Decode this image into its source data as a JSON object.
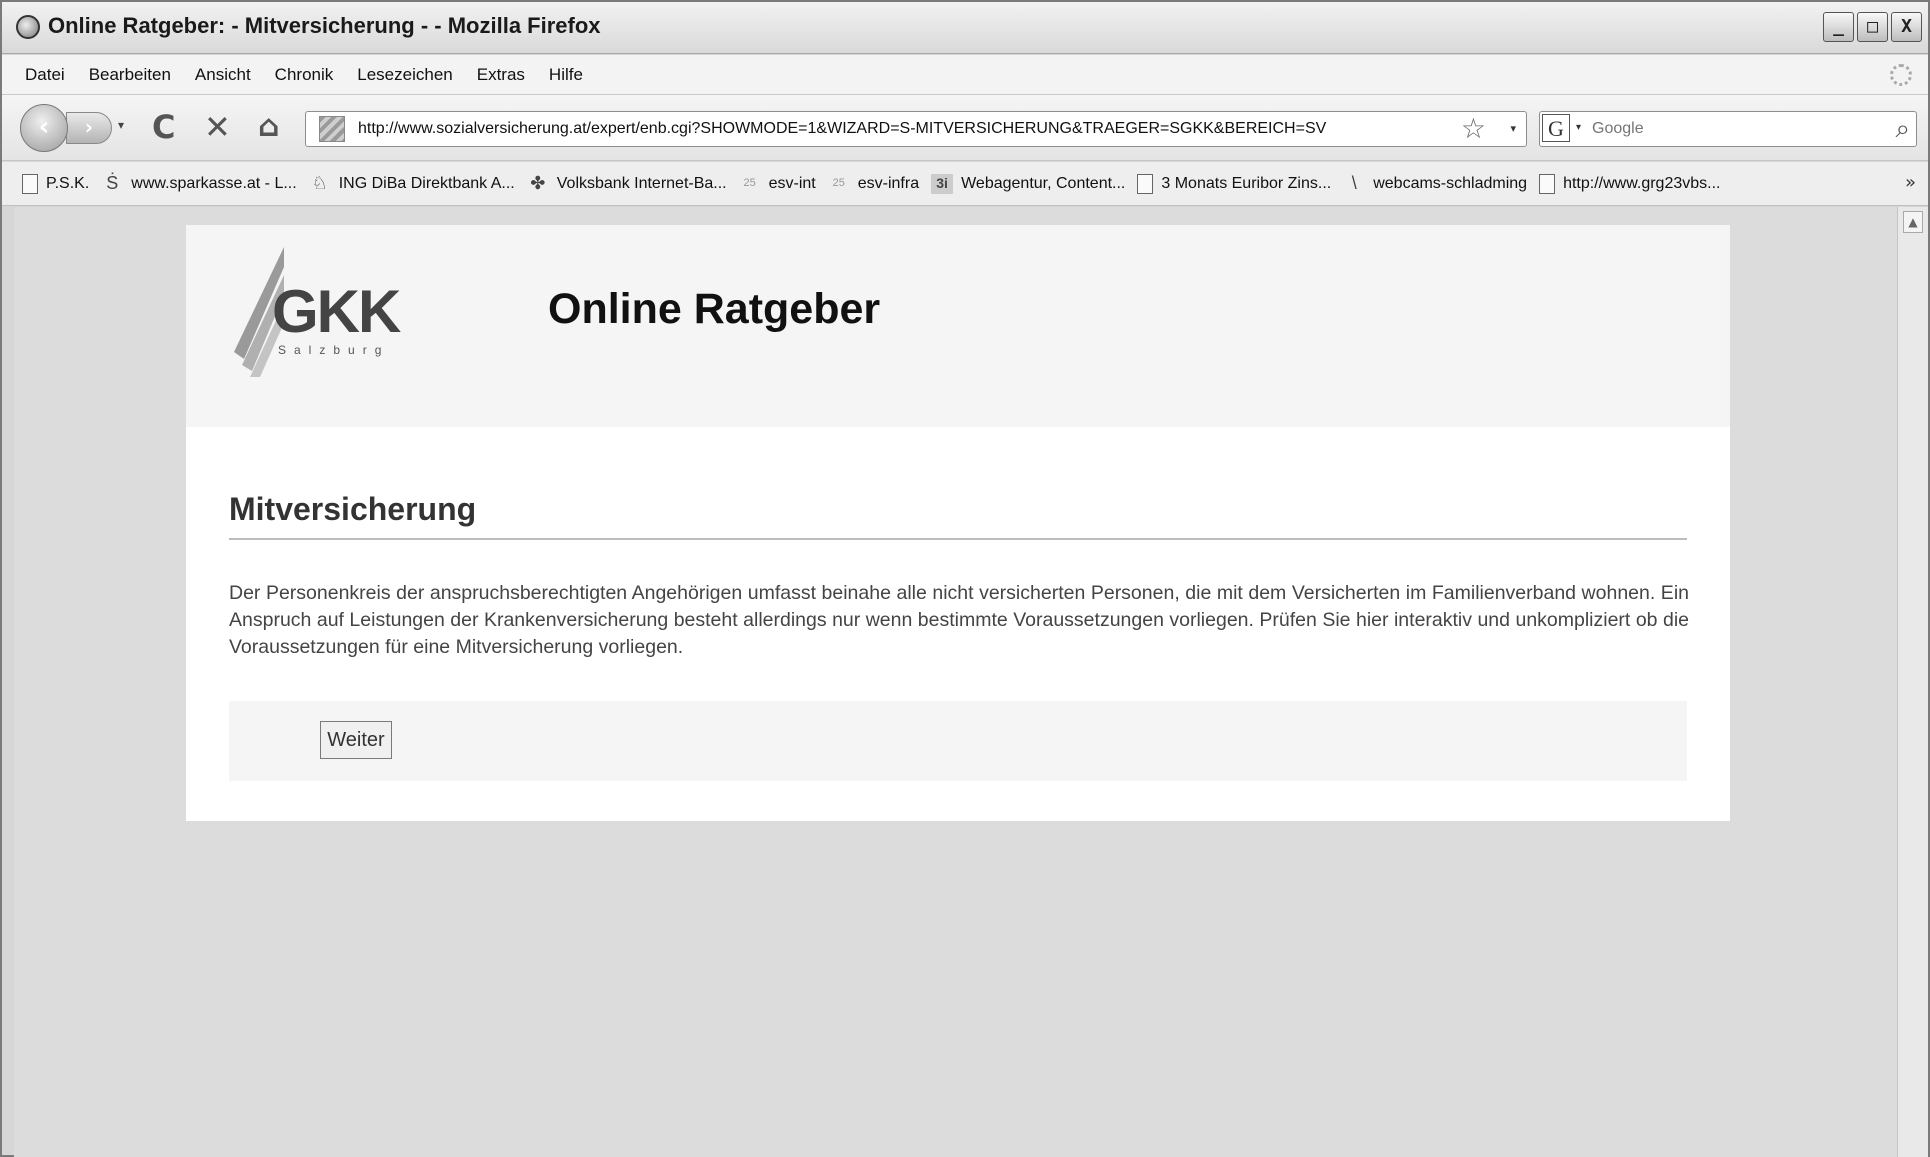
{
  "window": {
    "title": "Online Ratgeber: - Mitversicherung - - Mozilla Firefox",
    "controls": {
      "minimize": "_",
      "maximize": "□",
      "close": "X"
    }
  },
  "menubar": {
    "items": [
      "Datei",
      "Bearbeiten",
      "Ansicht",
      "Chronik",
      "Lesezeichen",
      "Extras",
      "Hilfe"
    ]
  },
  "navbar": {
    "back_glyph": "‹",
    "forward_glyph": "›",
    "reload_glyph": "C",
    "stop_glyph": "✕",
    "home_glyph": "⌂",
    "url": "http://www.sozialversicherung.at/expert/enb.cgi?SHOWMODE=1&WIZARD=S-MITVERSICHERUNG&TRAEGER=SGKK&BEREICH=SV",
    "star_glyph": "☆",
    "search_engine_glyph": "G",
    "search_placeholder": "Google",
    "search_go_glyph": "⌕"
  },
  "bookmarks": {
    "items": [
      {
        "label": "P.S.K.",
        "icon": "page-icon",
        "glyph": ""
      },
      {
        "label": "www.sparkasse.at - L...",
        "icon": "sparkasse-icon",
        "glyph": "Ṡ"
      },
      {
        "label": "ING DiBa Direktbank A...",
        "icon": "ing-icon",
        "glyph": "♘"
      },
      {
        "label": "Volksbank Internet-Ba...",
        "icon": "volksbank-icon",
        "glyph": "✤"
      },
      {
        "label": "esv-int",
        "icon": "esv-icon",
        "glyph": "25"
      },
      {
        "label": "esv-infra",
        "icon": "esv-icon",
        "glyph": "25"
      },
      {
        "label": "Webagentur, Content...",
        "icon": "3i-icon",
        "glyph": "3i"
      },
      {
        "label": "3 Monats Euribor Zins...",
        "icon": "page-icon",
        "glyph": ""
      },
      {
        "label": "webcams-schladming",
        "icon": "webcam-icon",
        "glyph": "\\"
      },
      {
        "label": "http://www.grg23vbs...",
        "icon": "page-icon",
        "glyph": ""
      }
    ],
    "more_glyph": "»"
  },
  "page": {
    "logo": {
      "text": "GKK",
      "subtext": "Salzburg"
    },
    "site_title": "Online Ratgeber",
    "section_title": "Mitversicherung",
    "intro": "Der Personenkreis der anspruchsberechtigten Angehörigen umfasst beinahe alle nicht versicherten Personen, die mit dem Versicherten im Familienverband wohnen. Ein Anspruch auf Leistungen der Krankenversicherung besteht allerdings nur wenn bestimmte Voraussetzungen vorliegen. Prüfen Sie hier interaktiv und unkompliziert ob die Voraussetzungen für eine Mitversicherung vorliegen.",
    "next_button": "Weiter"
  }
}
